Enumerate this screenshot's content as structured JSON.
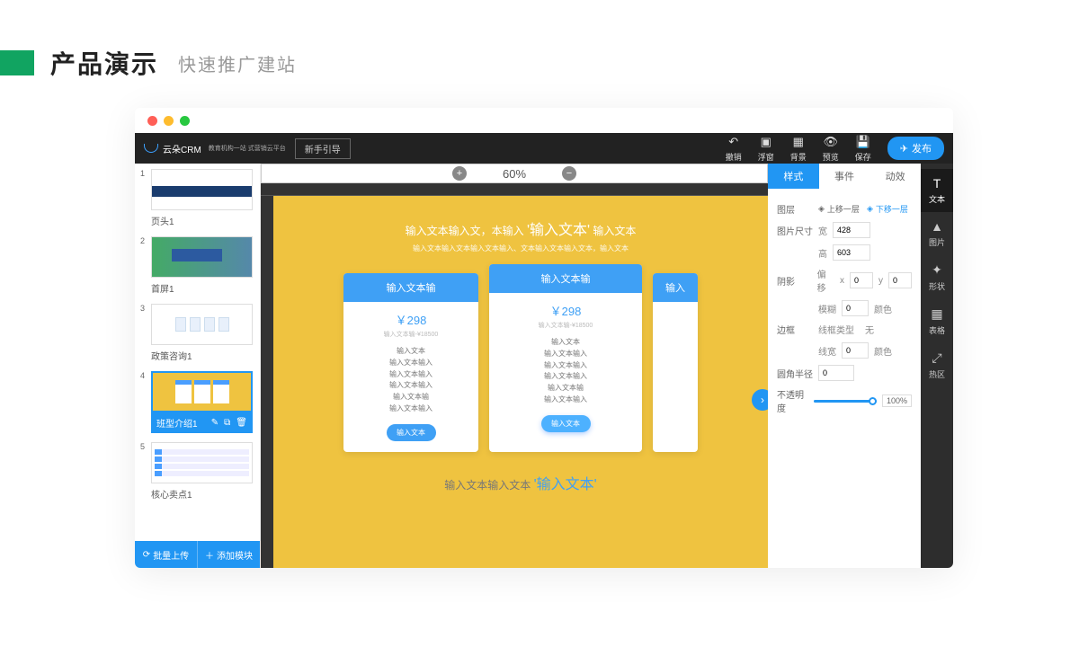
{
  "page_header": {
    "title": "产品演示",
    "subtitle": "快速推广建站"
  },
  "topbar": {
    "logo": "云朵CRM",
    "logo_sub": "教育机构一站\n式营销云平台",
    "guide": "新手引导",
    "icons": [
      {
        "label": "撤销"
      },
      {
        "label": "浮窗"
      },
      {
        "label": "背景"
      },
      {
        "label": "预览"
      },
      {
        "label": "保存"
      }
    ],
    "publish": "发布"
  },
  "zoom": {
    "value": "60%"
  },
  "thumbs": [
    {
      "num": "1",
      "label": "页头1"
    },
    {
      "num": "2",
      "label": "首屏1"
    },
    {
      "num": "3",
      "label": "政策咨询1"
    },
    {
      "num": "4",
      "label": "班型介绍1"
    },
    {
      "num": "5",
      "label": "核心卖点1"
    }
  ],
  "thumb_bottom": {
    "batch": "批量上传",
    "add": "添加模块"
  },
  "hero": {
    "line1_a": "输入文本输入文，本输入",
    "line1_b": "'输入文本'",
    "line1_c": "输入文本",
    "line2": "输入文本输入文本输入文本输入、文本输入文本输入文本，输入文本"
  },
  "cards": {
    "head": "输入文本输",
    "price": "￥298",
    "sub": "输入文本输-¥18500",
    "items": [
      "输入文本",
      "输入文本输入",
      "输入文本输入",
      "输入文本输入",
      "输入文本输",
      "输入文本输入"
    ],
    "btn": "输入文本"
  },
  "footer_a": "输入文本输入文本",
  "footer_b": "'输入文本'",
  "right_tabs": [
    "样式",
    "事件",
    "动效"
  ],
  "panel": {
    "layer": "图层",
    "up": "上移一层",
    "down": "下移一层",
    "size": "图片尺寸",
    "w": "宽",
    "w_val": "428",
    "h": "高",
    "h_val": "603",
    "shadow": "阴影",
    "offset": "偏移",
    "x": "x",
    "x_val": "0",
    "y": "y",
    "y_val": "0",
    "blur": "模糊",
    "blur_val": "0",
    "color": "颜色",
    "border": "边框",
    "line_type": "线框类型",
    "line_type_val": "无",
    "line_w": "线宽",
    "line_w_val": "0",
    "radius": "圆角半径",
    "radius_val": "0",
    "opacity": "不透明度",
    "opacity_val": "100%"
  },
  "right_sidebar": [
    {
      "label": "文本"
    },
    {
      "label": "图片"
    },
    {
      "label": "形状"
    },
    {
      "label": "表格"
    },
    {
      "label": "热区"
    }
  ]
}
